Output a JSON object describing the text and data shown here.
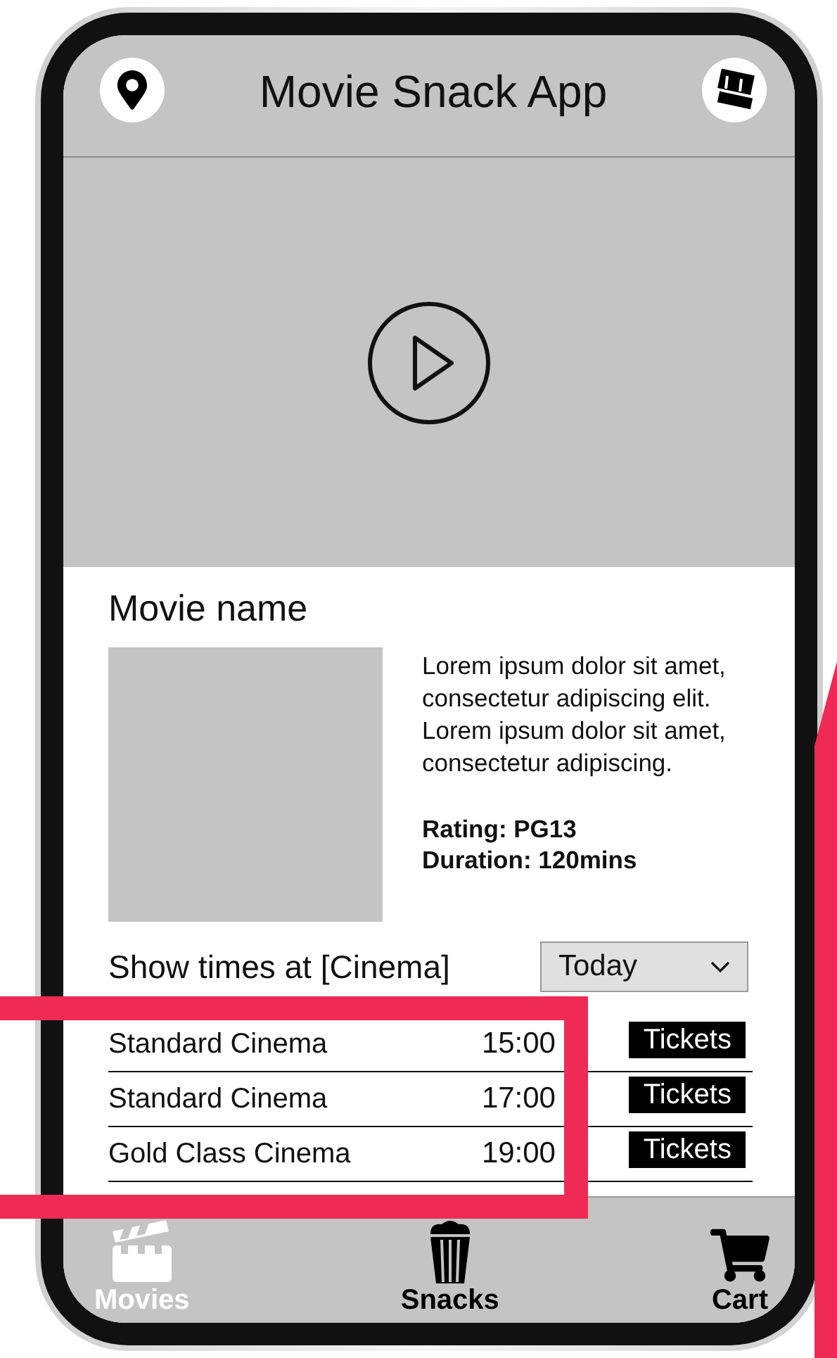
{
  "header": {
    "title": "Movie Snack App"
  },
  "movie": {
    "name": "Movie name",
    "description": "Lorem ipsum dolor sit amet, consectetur adipiscing elit. Lorem ipsum dolor sit amet, consectetur adipiscing.",
    "rating": "Rating: PG13",
    "duration": "Duration: 120mins"
  },
  "showtimes": {
    "heading": "Show times at [Cinema]",
    "day_select": {
      "value": "Today"
    },
    "rows": [
      {
        "cinema": "Standard Cinema",
        "time": "15:00",
        "button": "Tickets"
      },
      {
        "cinema": "Standard Cinema",
        "time": "17:00",
        "button": "Tickets"
      },
      {
        "cinema": "Gold Class Cinema",
        "time": "19:00",
        "button": "Tickets"
      }
    ]
  },
  "nav": [
    {
      "kind": "movies",
      "label": "Movies",
      "selected": true
    },
    {
      "kind": "snacks",
      "label": "Snacks",
      "selected": false
    },
    {
      "kind": "cart",
      "label": "Cart",
      "selected": false
    }
  ]
}
